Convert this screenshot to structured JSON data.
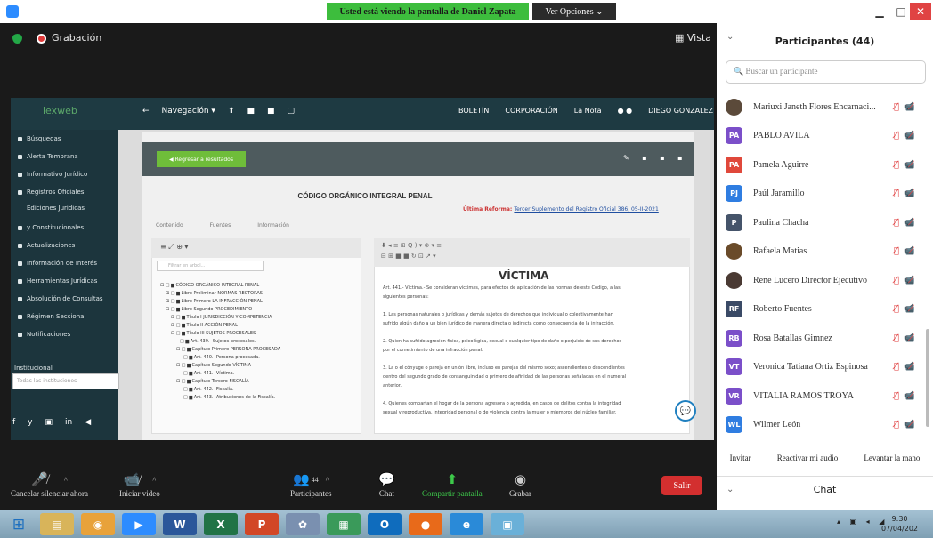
{
  "titlebar": {
    "share_banner": "Usted está viendo la pantalla de Daniel Zapata",
    "view_options": "Ver Opciones ⌄"
  },
  "meeting": {
    "recording_label": "Grabación",
    "view_label": "▦ Vista"
  },
  "shared_screen": {
    "logo": "lexweb",
    "nav": [
      "←",
      "Navegación ▾",
      "⬆",
      "■",
      "■",
      "▢"
    ],
    "header_right": [
      "BOLETÍN",
      "CORPORACIÓN",
      "La Nota",
      "● ●",
      "DIEGO GONZALEZ"
    ],
    "sidebar": [
      "Búsquedas",
      "Alerta Temprana",
      "Informativo Jurídico",
      "Registros Oficiales",
      "Ediciones Jurídicas",
      "y Constitucionales",
      "Actualizaciones",
      "Información de Interés",
      "Herramientas Jurídicas",
      "Absolución de Consultas",
      "Régimen Seccional",
      "Notificaciones"
    ],
    "institucional_label": "Institucional",
    "institucional_select": "Todas las instituciones",
    "social": [
      "f",
      "y",
      "▣",
      "in",
      "◀"
    ],
    "back_button": "◀ Regresar a resultados",
    "doc_icons": "✎ ▪ ▪ ▪",
    "doc_title": "CÓDIGO ORGÁNICO INTEGRAL PENAL",
    "reform_prefix": "Última Reforma: ",
    "reform_link": "Tercer Suplemento del Registro Oficial 386, 05-II-2021",
    "doc_tabs": [
      "Contenido",
      "Fuentes",
      "Información"
    ],
    "tree_toolbar": "≡   ⤢   ⊕ ▾",
    "tree_search": "Filtrar en árbol...",
    "tree": [
      "⊟ □ ▆ CÓDIGO ORGÁNICO INTEGRAL PENAL",
      "⊞ □ ▆ Libro Preliminar NORMAS RECTORAS",
      "⊞ □ ▆ Libro Primero LA INFRACCIÓN PENAL",
      "⊟ □ ▆ Libro Segundo PROCEDIMIENTO",
      "⊞ □ ▆ Título I JURISDICCIÓN Y COMPETENCIA",
      "⊞ □ ▆ Título II ACCIÓN PENAL",
      "⊟ □ ▆ Título III SUJETOS PROCESALES",
      "□ ▆ Art. 439.- Sujetos procesales.-",
      "⊟ □ ▆ Capítulo Primero PERSONA PROCESADA",
      "□ ▆ Art. 440.- Persona procesada.-",
      "⊟ □ ▆ Capítulo Segundo VÍCTIMA",
      "□ ▆ Art. 441.- Víctima.-",
      "⊟ □ ▆ Capítulo Tercero FISCALÍA",
      "□ ▆ Art. 442.- Fiscalía.-",
      "□ ▆ Art. 443.- Atribuciones de la Fiscalía.-"
    ],
    "art_toolbar_1": "⬇   ◂   ≡   ⊞   Q   ) ▾   ⊕ ▾   ≡",
    "art_toolbar_2": "⊟   ⊞   ■   ■   ↻   ⊡   ↗ ▾",
    "art_heading": "VÍCTIMA",
    "art_lines": [
      "Art. 441.- Víctima.- Se consideran víctimas, para efectos de aplicación de las normas de este Código, a las",
      "siguientes personas:",
      "1. Las personas naturales o jurídicas y demás sujetos de derechos que individual o colectivamente han",
      "sufrido algún daño a un bien jurídico de manera directa o indirecta como consecuencia de la infracción.",
      "2. Quien ha sufrido agresión física, psicológica, sexual o cualquier tipo de daño o perjuicio de sus derechos",
      "por el cometimiento de una infracción penal.",
      "3. La o el cónyuge o pareja en unión libre, incluso en parejas del mismo sexo; ascendientes o descendientes",
      "dentro del segundo grado de consanguinidad o primero de afinidad de las personas señaladas en el numeral",
      "anterior.",
      "4. Quienes compartan el hogar de la persona agresora o agredida, en casos de delitos contra la integridad",
      "sexual y reproductiva, integridad personal o de violencia contra la mujer o miembros del núcleo familiar."
    ]
  },
  "controls": {
    "mute_label": "Cancelar silenciar ahora",
    "video_label": "Iniciar video",
    "participants_label": "Participantes",
    "participants_count": "44",
    "chat_label": "Chat",
    "share_label": "Compartir pantalla",
    "record_label": "Grabar",
    "leave_label": "Salir"
  },
  "panel": {
    "title": "Participantes (44)",
    "search_placeholder": "Buscar un participante",
    "participants": [
      {
        "name": "Mariuxi Janeth Flores Encarnaci...",
        "initials": "",
        "color": "#5b4a3a",
        "photo": true
      },
      {
        "name": "PABLO AVILA",
        "initials": "PA",
        "color": "#7b4fc9",
        "photo": false
      },
      {
        "name": "Pamela Aguirre",
        "initials": "PA",
        "color": "#e0483b",
        "photo": false
      },
      {
        "name": "Paúl Jaramillo",
        "initials": "PJ",
        "color": "#2f7de1",
        "photo": false
      },
      {
        "name": "Paulina Chacha",
        "initials": "P",
        "color": "#45546a",
        "photo": false
      },
      {
        "name": "Rafaela Matias",
        "initials": "",
        "color": "#6a4b2a",
        "photo": true
      },
      {
        "name": "Rene Lucero Director Ejecutivo",
        "initials": "",
        "color": "#4a3a33",
        "photo": true
      },
      {
        "name": "Roberto Fuentes-",
        "initials": "RF",
        "color": "#3a4a66",
        "photo": false
      },
      {
        "name": "Rosa Batallas Gimnez",
        "initials": "RB",
        "color": "#7b4fc9",
        "photo": false
      },
      {
        "name": "Veronica Tatiana Ortiz Espinosa",
        "initials": "VT",
        "color": "#7b4fc9",
        "photo": false
      },
      {
        "name": "VITALIA RAMOS TROYA",
        "initials": "VR",
        "color": "#7b4fc9",
        "photo": false
      },
      {
        "name": "Wilmer León",
        "initials": "WL",
        "color": "#2f7de1",
        "photo": false
      }
    ],
    "actions": [
      "Invitar",
      "Reactivar mi audio",
      "Levantar la mano"
    ],
    "chat_title": "Chat"
  },
  "taskbar": {
    "apps": [
      {
        "label": "▤",
        "color": "#d8b45a"
      },
      {
        "label": "◉",
        "color": "#e8a23a"
      },
      {
        "label": "▶",
        "color": "#2d8cff"
      },
      {
        "label": "W",
        "color": "#2b579a"
      },
      {
        "label": "X",
        "color": "#217346"
      },
      {
        "label": "P",
        "color": "#d24726"
      },
      {
        "label": "✿",
        "color": "#7a90b0"
      },
      {
        "label": "▦",
        "color": "#3a9a5a"
      },
      {
        "label": "O",
        "color": "#0f6cbd"
      },
      {
        "label": "●",
        "color": "#e86a1a"
      },
      {
        "label": "e",
        "color": "#2a8ad8"
      },
      {
        "label": "▣",
        "color": "#6ab0d8"
      }
    ],
    "tray": "▴ ▣ ◂ ◢",
    "time": "9:30",
    "date": "07/04/202"
  }
}
